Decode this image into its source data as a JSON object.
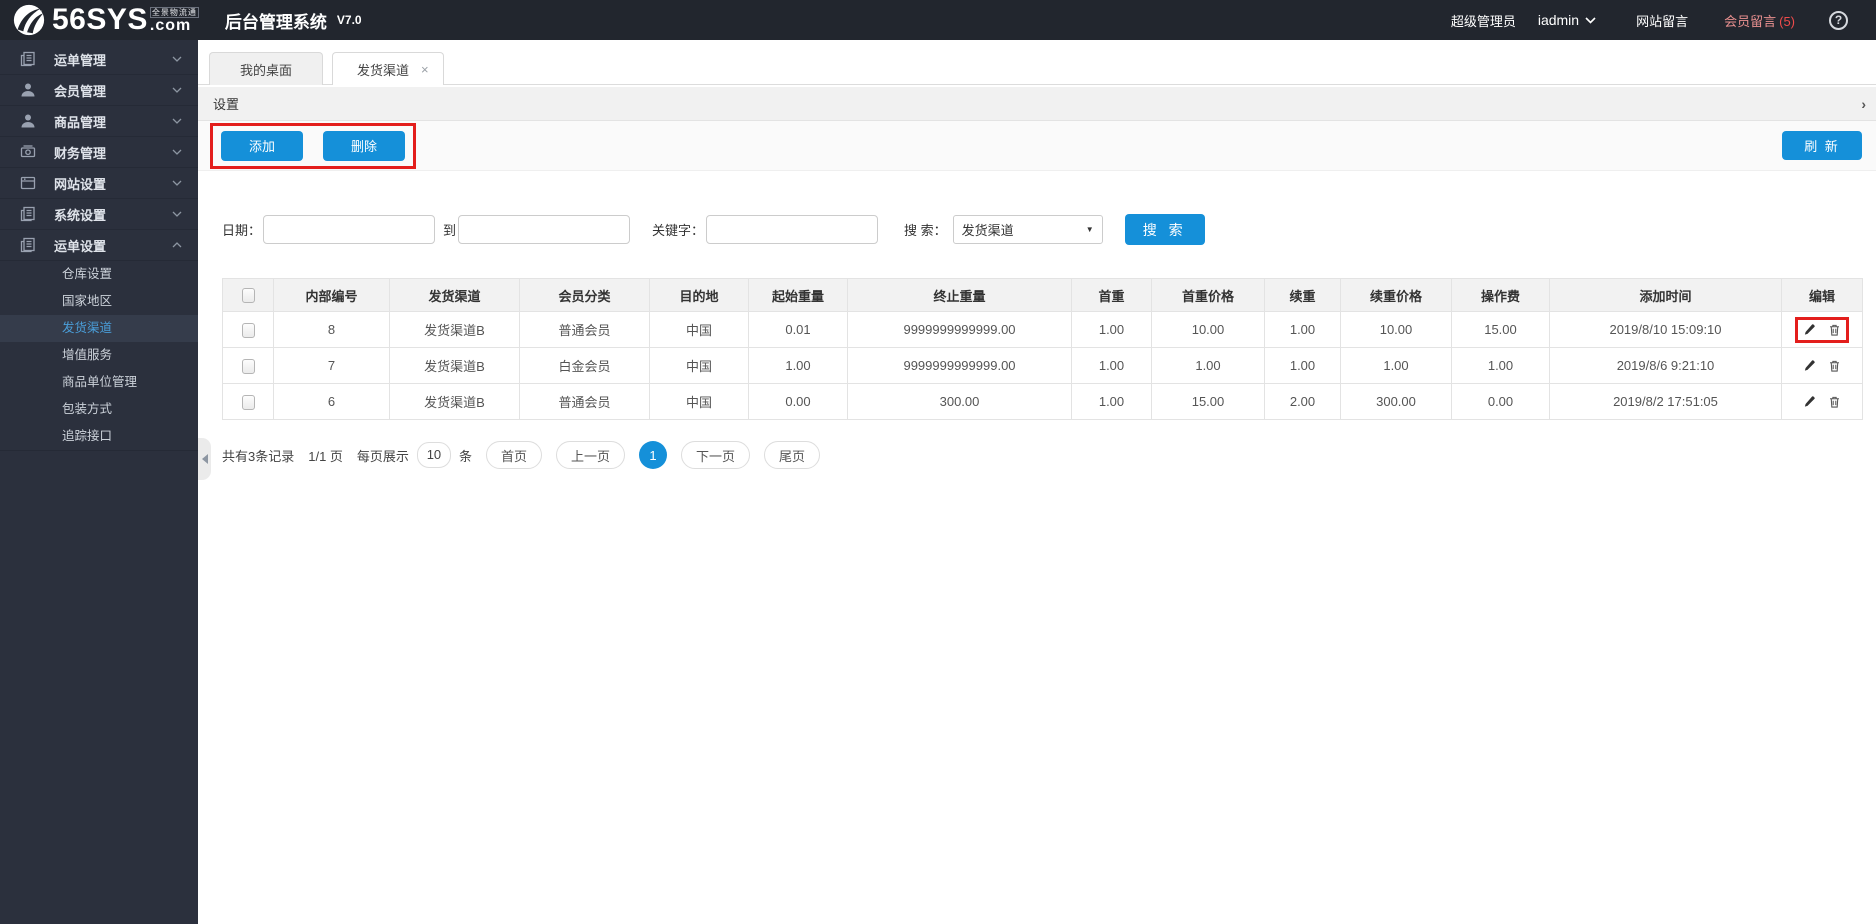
{
  "topbar": {
    "logo_text": "56SYS",
    "logo_dotcom": ".com",
    "logo_tagline": "全景物流通",
    "app_title": "后台管理系统",
    "version": "V7.0",
    "role": "超级管理员",
    "username": "iadmin",
    "site_messages": "网站留言",
    "member_messages": "会员留言",
    "member_messages_count": "(5)",
    "help_glyph": "?"
  },
  "sidebar": {
    "items": [
      {
        "label": "运单管理"
      },
      {
        "label": "会员管理"
      },
      {
        "label": "商品管理"
      },
      {
        "label": "财务管理"
      },
      {
        "label": "网站设置"
      },
      {
        "label": "系统设置"
      },
      {
        "label": "运单设置"
      }
    ],
    "submenu": [
      {
        "label": "仓库设置",
        "active": false
      },
      {
        "label": "国家地区",
        "active": false
      },
      {
        "label": "发货渠道",
        "active": true
      },
      {
        "label": "增值服务",
        "active": false
      },
      {
        "label": "商品单位管理",
        "active": false
      },
      {
        "label": "包装方式",
        "active": false
      },
      {
        "label": "追踪接口",
        "active": false
      }
    ]
  },
  "tabs": {
    "desktop": "我的桌面",
    "current": "发货渠道",
    "close_glyph": "×"
  },
  "panel": {
    "title": "设置",
    "chevron_glyph": "›"
  },
  "toolbar": {
    "add_label": "添加",
    "delete_label": "删除",
    "refresh_label": "刷 新"
  },
  "search": {
    "date_label": "日期：",
    "to_label": "到",
    "keyword_label": "关键字：",
    "type_label": "搜 索：",
    "type_value": "发货渠道",
    "dropdown_glyph": "▼",
    "button_label": "搜 索"
  },
  "table": {
    "headers": [
      "内部编号",
      "发货渠道",
      "会员分类",
      "目的地",
      "起始重量",
      "终止重量",
      "首重",
      "首重价格",
      "续重",
      "续重价格",
      "操作费",
      "添加时间",
      "编辑"
    ],
    "rows": [
      {
        "cells": [
          "8",
          "发货渠道B",
          "普通会员",
          "中国",
          "0.01",
          "9999999999999.00",
          "1.00",
          "10.00",
          "1.00",
          "10.00",
          "15.00",
          "2019/8/10 15:09:10"
        ],
        "edit_highlight": true
      },
      {
        "cells": [
          "7",
          "发货渠道B",
          "白金会员",
          "中国",
          "1.00",
          "9999999999999.00",
          "1.00",
          "1.00",
          "1.00",
          "1.00",
          "1.00",
          "2019/8/6 9:21:10"
        ],
        "edit_highlight": false
      },
      {
        "cells": [
          "6",
          "发货渠道B",
          "普通会员",
          "中国",
          "0.00",
          "300.00",
          "1.00",
          "15.00",
          "2.00",
          "300.00",
          "0.00",
          "2019/8/2 17:51:05"
        ],
        "edit_highlight": false
      }
    ]
  },
  "pagination": {
    "summary": "共有3条记录",
    "page_info": "1/1 页",
    "per_page_label": "每页展示",
    "per_page_value": "10",
    "unit_label": "条",
    "first": "首页",
    "prev": "上一页",
    "current_page": "1",
    "next": "下一页",
    "last": "尾页"
  },
  "colors": {
    "accent_blue": "#1590d9",
    "annotation_red": "#e31e1c",
    "topbar_bg": "#22262e",
    "sidebar_bg": "#2b303d",
    "active_link_blue": "#4a9ed9",
    "member_msg_red": "#ef4b4b"
  }
}
